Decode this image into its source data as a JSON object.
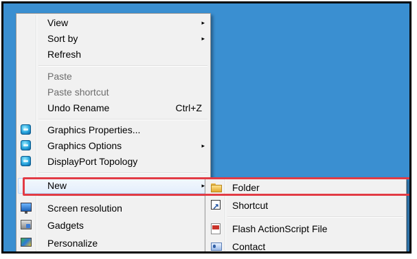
{
  "context_menu": {
    "items": [
      {
        "label": "View",
        "submenu": true
      },
      {
        "label": "Sort by",
        "submenu": true
      },
      {
        "label": "Refresh"
      },
      {
        "label": "Paste",
        "disabled": true
      },
      {
        "label": "Paste shortcut",
        "disabled": true
      },
      {
        "label": "Undo Rename",
        "shortcut": "Ctrl+Z"
      },
      {
        "label": "Graphics Properties...",
        "icon": "intel-graphics-icon"
      },
      {
        "label": "Graphics Options",
        "icon": "intel-graphics-icon",
        "submenu": true
      },
      {
        "label": "DisplayPort Topology",
        "icon": "intel-graphics-icon"
      },
      {
        "label": "New",
        "submenu": true,
        "highlighted": true
      },
      {
        "label": "Screen resolution",
        "icon": "monitor-icon"
      },
      {
        "label": "Gadgets",
        "icon": "gadgets-icon"
      },
      {
        "label": "Personalize",
        "icon": "personalize-icon"
      }
    ]
  },
  "new_submenu": {
    "items": [
      {
        "label": "Folder",
        "icon": "folder-icon"
      },
      {
        "label": "Shortcut",
        "icon": "shortcut-icon"
      },
      {
        "label": "Flash ActionScript File",
        "icon": "flash-file-icon"
      },
      {
        "label": "Contact",
        "icon": "contact-icon"
      }
    ]
  },
  "colors": {
    "desktop": "#3a8fd1",
    "menu_bg": "#f1f1f1",
    "annotation_red": "#e23b44"
  },
  "glyphs": {
    "arrow": "▸"
  }
}
